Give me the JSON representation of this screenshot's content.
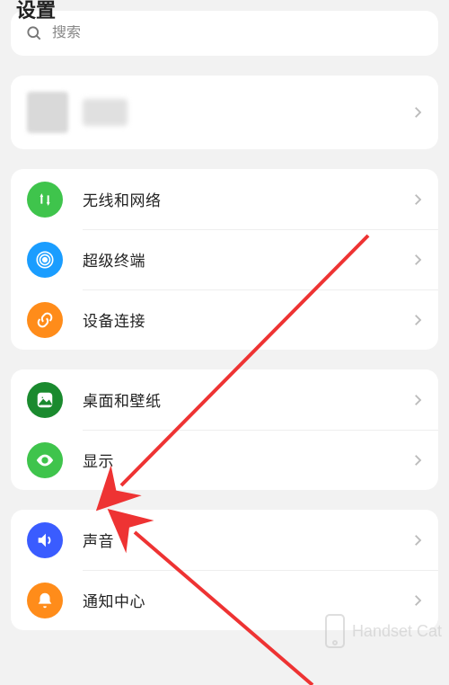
{
  "page_title": "设置",
  "search": {
    "placeholder": "搜索"
  },
  "account": {
    "name": ""
  },
  "groups": [
    {
      "items": [
        {
          "icon": "network-icon",
          "color": "#3fc44c",
          "label": "无线和网络"
        },
        {
          "icon": "super-device-icon",
          "color": "#1a9dff",
          "label": "超级终端"
        },
        {
          "icon": "link-icon",
          "color": "#ff8c1a",
          "label": "设备连接"
        }
      ]
    },
    {
      "items": [
        {
          "icon": "wallpaper-icon",
          "color": "#1a8a2e",
          "label": "桌面和壁纸"
        },
        {
          "icon": "display-icon",
          "color": "#3fc44c",
          "label": "显示"
        }
      ]
    },
    {
      "items": [
        {
          "icon": "sound-icon",
          "color": "#3a5cff",
          "label": "声音"
        },
        {
          "icon": "notification-icon",
          "color": "#ff8c1a",
          "label": "通知中心"
        }
      ]
    }
  ],
  "watermark": "Handset Cat"
}
